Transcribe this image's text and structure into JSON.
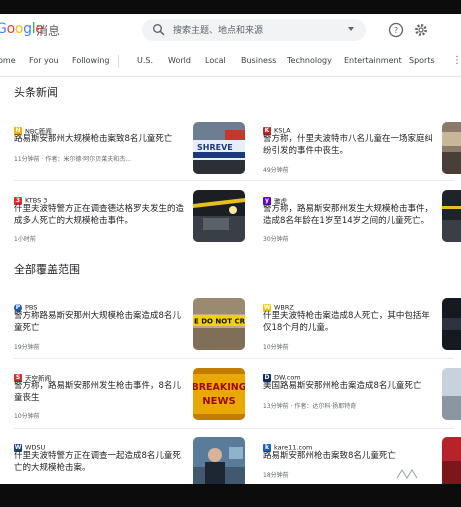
{
  "header": {
    "logo_text": "Google",
    "logo_suffix": "消息",
    "search_placeholder": "搜索主题、地点和来源"
  },
  "nav": {
    "items": [
      "ome",
      "For you",
      "Following",
      "U.S.",
      "World",
      "Local",
      "Business",
      "Technology",
      "Entertainment",
      "Sports"
    ]
  },
  "sections": {
    "top": "头条新闻",
    "full": "全部覆盖范围"
  },
  "stories": [
    {
      "source": "NBC新闻",
      "badge": "N",
      "badge_color": "#f4b400",
      "headline": "路易斯安那州大规模枪击案致8名儿童死亡",
      "meta": "11分钟前 · 作者：米尔德·阿尔贝莱夫和杰...",
      "thumb": "police"
    },
    {
      "source": "KSLA",
      "badge": "K",
      "badge_color": "#c62828",
      "headline": "警方称，什里夫波特市八名儿童在一场家庭纠纷引发的事件中丧生。",
      "meta": "49分钟前",
      "thumb": "partial-crowd"
    },
    {
      "source": "KTBS 3",
      "badge": "3",
      "badge_color": "#d32f2f",
      "headline": "什里夫波特警方正在调查德达格罗夫发生的造成多人死亡的大规模枪击事件。",
      "meta": "1小时前",
      "thumb": "night"
    },
    {
      "source": "雅虎",
      "badge": "y",
      "badge_color": "#6001d2",
      "headline": "警方称，路易斯安那州发生大规模枪击事件，造成8名年龄在1岁至14岁之间的儿童死亡。",
      "meta": "30分钟前",
      "thumb": "partial-night"
    },
    {
      "source": "PBS",
      "badge": "P",
      "badge_color": "#1e5aa8",
      "headline": "警方称路易斯安那州大规模枪击案造成8名儿童死亡",
      "meta": "19分钟前",
      "thumb": "tape"
    },
    {
      "source": "WBRZ",
      "badge": "W",
      "badge_color": "#f5c400",
      "headline": "什里夫波特枪击案造成8人死亡，其中包括年仅18个月的儿童。",
      "meta": "10分钟前",
      "thumb": "partial-dark"
    },
    {
      "source": "天空新闻",
      "badge": "S",
      "badge_color": "#d32f2f",
      "headline": "警方称，路易斯安那州发生枪击事件，8名儿童丧生",
      "meta": "10分钟前",
      "thumb": "breaking"
    },
    {
      "source": "DW.com",
      "badge": "D",
      "badge_color": "#0a2a66",
      "headline": "美国路易斯安那州枪击案造成8名儿童死亡",
      "meta": "13分钟前 · 作者：达尔科·扬耶特奇",
      "thumb": "partial-light"
    },
    {
      "source": "WDSU",
      "badge": "W",
      "badge_color": "#1a3f8a",
      "headline": "什里夫波特警方正在调查一起造成8名儿童死亡的大规模枪击案。",
      "meta": "",
      "thumb": "person"
    },
    {
      "source": "kare11.com",
      "badge": "k",
      "badge_color": "#1565c0",
      "headline": "路易斯安那州枪击案致8名儿童死亡",
      "meta": "18分钟前",
      "thumb": "partial-red"
    }
  ],
  "breaking_text": [
    "BREAKING",
    "NEWS"
  ],
  "tape_text": "E DO NOT CROSS"
}
